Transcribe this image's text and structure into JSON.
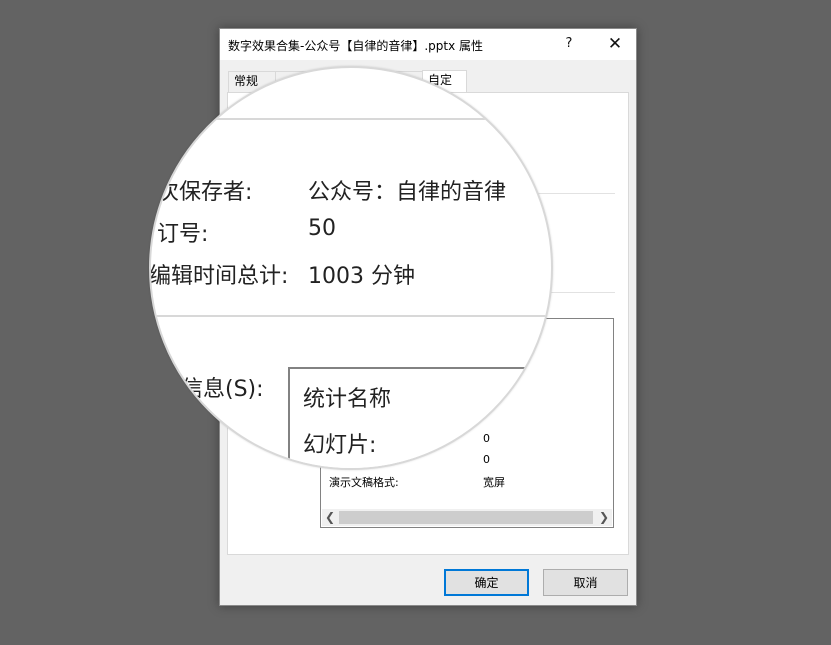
{
  "window": {
    "title": "数字效果合集-公众号【自律的音律】.pptx 属性",
    "help_label": "?",
    "close_label": "✕"
  },
  "tabs": {
    "general": "常规",
    "custom": "自定义"
  },
  "stats_list": {
    "rows": [
      {
        "label": "",
        "value": "0"
      },
      {
        "label": "",
        "value": "0"
      },
      {
        "label": "演示文稿格式:",
        "value": "宽屏"
      }
    ]
  },
  "buttons": {
    "ok": "确定",
    "cancel": "取消"
  },
  "magnifier": {
    "last_saved_by_label": "次保存者:",
    "last_saved_by_value": "公众号：自律的音律",
    "revision_label": "订号:",
    "revision_value": "50",
    "edit_time_label": "编辑时间总计:",
    "edit_time_value": "1003 分钟",
    "stats_label": "信息(S):",
    "col_header": "统计名称",
    "slides_label": "幻灯片:"
  },
  "icons": {
    "help": "question-mark-icon",
    "close": "close-icon",
    "scroll_left": "chevron-left-icon",
    "scroll_right": "chevron-right-icon"
  }
}
